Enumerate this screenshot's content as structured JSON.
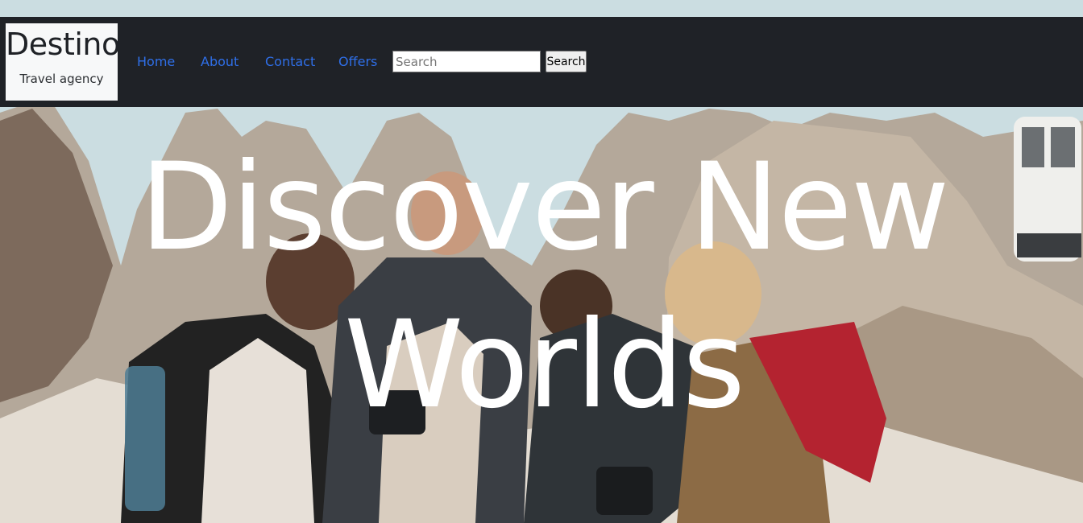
{
  "brand": {
    "name": "Destino",
    "tagline": "Travel agency"
  },
  "nav": {
    "links": [
      {
        "label": "Home"
      },
      {
        "label": "About"
      },
      {
        "label": "Contact"
      },
      {
        "label": "Offers"
      }
    ]
  },
  "search": {
    "placeholder": "Search",
    "value": "",
    "button_label": "Search"
  },
  "hero": {
    "title": "Discover New Worlds",
    "background_image": "group of four young travelers with backpacks and cameras laughing in front of rocky mountains and a cable car"
  },
  "colors": {
    "navbar_bg": "#1f2227",
    "brand_bg": "#f7f8f9",
    "link": "#2f6fe8",
    "hero_text": "#ffffff"
  }
}
